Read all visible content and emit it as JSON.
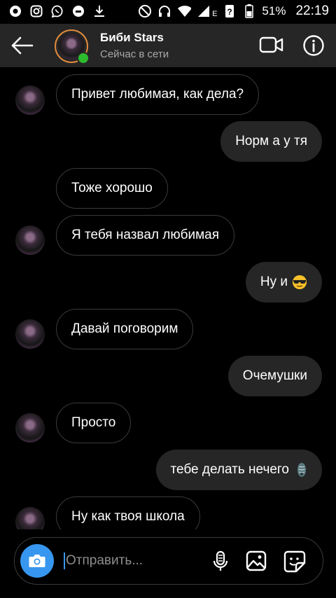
{
  "status_bar": {
    "battery": "51%",
    "time": "22:19",
    "network_letter": "E"
  },
  "header": {
    "name": "Биби Stars",
    "status": "Сейчас в сети"
  },
  "messages": [
    {
      "from": "them",
      "text": "Привет любимая, как дела?"
    },
    {
      "from": "me",
      "text": "Норм а у тя"
    },
    {
      "from": "them",
      "text": "Тоже хорошо"
    },
    {
      "from": "them",
      "text": "Я тебя назвал любимая"
    },
    {
      "from": "me",
      "text": "Ну и",
      "emoji": "sunglasses-face-emoji"
    },
    {
      "from": "them",
      "text": "Давай поговорим"
    },
    {
      "from": "me",
      "text": "Очемушки"
    },
    {
      "from": "them",
      "text": "Просто"
    },
    {
      "from": "me",
      "text": "тебе делать нечего",
      "emoji": "pupa-emoji"
    },
    {
      "from": "them",
      "text": "Ну как твоя школа"
    }
  ],
  "composer": {
    "placeholder": "Отправить..."
  },
  "colors": {
    "header_bg": "#262626",
    "outgoing_bubble": "#262626",
    "accent": "#3797f0",
    "online": "#2dbb2d"
  }
}
